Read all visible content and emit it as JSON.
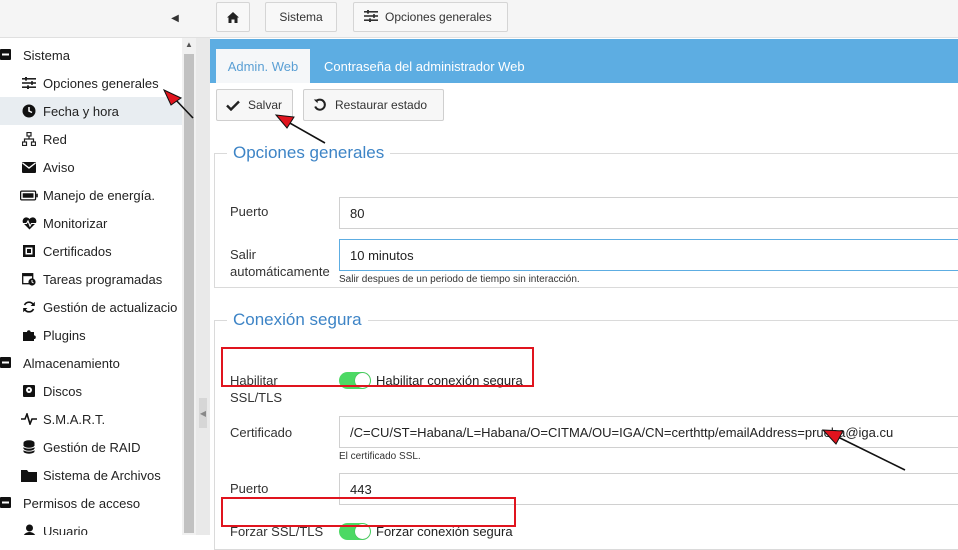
{
  "topbar": {
    "home_icon": "home-icon",
    "breadcrumb": [
      "Sistema",
      "Opciones generales"
    ]
  },
  "sidebar": {
    "rows": [
      {
        "type": "group",
        "icon": "minus-square-icon",
        "label": "Sistema"
      },
      {
        "type": "item",
        "icon": "sliders-icon",
        "label": "Opciones generales"
      },
      {
        "type": "item",
        "icon": "clock-icon",
        "label": "Fecha y hora",
        "active": true
      },
      {
        "type": "item",
        "icon": "network-icon",
        "label": "Red"
      },
      {
        "type": "item",
        "icon": "envelope-icon",
        "label": "Aviso"
      },
      {
        "type": "item",
        "icon": "battery-icon",
        "label": "Manejo de energía."
      },
      {
        "type": "item",
        "icon": "heartbeat-icon",
        "label": "Monitorizar"
      },
      {
        "type": "item",
        "icon": "certificate-icon",
        "label": "Certificados"
      },
      {
        "type": "item",
        "icon": "calendar-clock-icon",
        "label": "Tareas programadas"
      },
      {
        "type": "item",
        "icon": "refresh-icon",
        "label": "Gestión de actualizacio"
      },
      {
        "type": "item",
        "icon": "puzzle-icon",
        "label": "Plugins"
      },
      {
        "type": "group",
        "icon": "minus-square-icon",
        "label": "Almacenamiento"
      },
      {
        "type": "item",
        "icon": "disk-icon",
        "label": "Discos"
      },
      {
        "type": "item",
        "icon": "pulse-icon",
        "label": "S.M.A.R.T."
      },
      {
        "type": "item",
        "icon": "database-icon",
        "label": "Gestión de RAID"
      },
      {
        "type": "item",
        "icon": "folder-icon",
        "label": "Sistema de Archivos"
      },
      {
        "type": "group",
        "icon": "minus-square-icon",
        "label": "Permisos de acceso"
      },
      {
        "type": "item",
        "icon": "user-icon",
        "label": "Usuario"
      }
    ]
  },
  "tabs": {
    "admin": "Admin. Web",
    "password": "Contraseña del administrador Web"
  },
  "toolbar": {
    "save": "Salvar",
    "restore": "Restaurar estado"
  },
  "general": {
    "legend": "Opciones generales",
    "port_label": "Puerto",
    "port_value": "80",
    "logout_label_1": "Salir",
    "logout_label_2": "automáticamente",
    "logout_value": "10 minutos",
    "logout_hint": "Salir despues de un periodo de tiempo sin interacción."
  },
  "secure": {
    "legend": "Conexión segura",
    "ssl_label_1": "Habilitar",
    "ssl_label_2": "SSL/TLS",
    "ssl_toggle_label": "Habilitar conexión segura",
    "ssl_enabled": true,
    "cert_label": "Certificado",
    "cert_value": "/C=CU/ST=Habana/L=Habana/O=CITMA/OU=IGA/CN=certhttp/emailAddress=prueba@iga.cu",
    "cert_hint": "El certificado SSL.",
    "port_label": "Puerto",
    "port_value": "443",
    "force_label": "Forzar SSL/TLS",
    "force_toggle_label": "Forzar conexión segura",
    "force_enabled": true
  },
  "colors": {
    "accent": "#5dade2",
    "legend": "#3d84c6",
    "toggle_on": "#4cd964",
    "annotation": "#e0141e"
  }
}
